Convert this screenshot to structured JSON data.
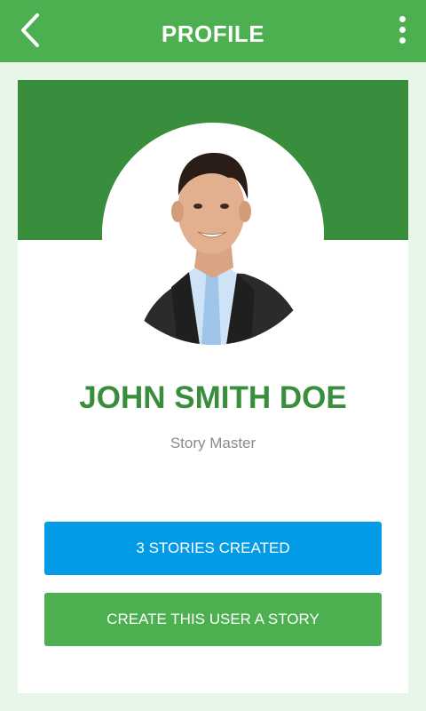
{
  "header": {
    "title": "PROFILE",
    "back_icon": "chevron-left-icon",
    "menu_icon": "more-vertical-icon"
  },
  "profile": {
    "name": "JOHN SMITH DOE",
    "role": "Story Master",
    "avatar": "profile-photo"
  },
  "actions": {
    "stories_label": "3 STORIES CREATED",
    "create_label": "CREATE THIS USER A STORY"
  },
  "colors": {
    "appbar": "#4caf50",
    "banner": "#388e3c",
    "name": "#388e3c",
    "stories_button": "#039be5",
    "create_button": "#4caf50",
    "background": "#e8f5e9"
  }
}
